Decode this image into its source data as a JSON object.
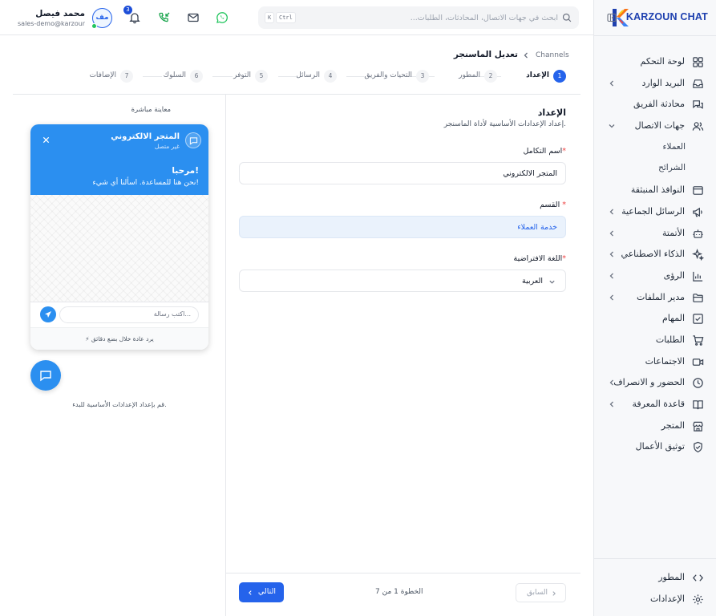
{
  "sidebar": {
    "brand": "KARZOUN CHAT",
    "items": [
      {
        "label": "لوحة التحكم",
        "icon": "grid-icon",
        "chevron": false
      },
      {
        "label": "البريد الوارد",
        "icon": "inbox-icon",
        "chevron": true
      },
      {
        "label": "محادثة الفريق",
        "icon": "chat-bubbles-icon",
        "chevron": false
      },
      {
        "label": "جهات الاتصال",
        "icon": "users-icon",
        "chevron": true,
        "expanded": true
      },
      {
        "label": "العملاء",
        "sub": true
      },
      {
        "label": "الشرائح",
        "sub": true
      },
      {
        "label": "النوافذ المنبثقة",
        "icon": "window-icon",
        "chevron": false
      },
      {
        "label": "الرسائل الجماعية",
        "icon": "megaphone-icon",
        "chevron": true
      },
      {
        "label": "الأتمتة",
        "icon": "bot-icon",
        "chevron": true
      },
      {
        "label": "الذكاء الاصطناعي",
        "icon": "sparkles-icon",
        "chevron": true
      },
      {
        "label": "الرؤى",
        "icon": "bar-chart-icon",
        "chevron": true
      },
      {
        "label": "مدير الملفات",
        "icon": "folder-icon",
        "chevron": true
      },
      {
        "label": "المهام",
        "icon": "checkbox-icon",
        "chevron": false
      },
      {
        "label": "الطلبات",
        "icon": "cart-icon",
        "chevron": false
      },
      {
        "label": "الاجتماعات",
        "icon": "video-icon",
        "chevron": false
      },
      {
        "label": "الحضور و الانصراف",
        "icon": "clock-icon",
        "chevron": true
      },
      {
        "label": "قاعدة المعرفة",
        "icon": "book-icon",
        "chevron": true
      },
      {
        "label": "المتجر",
        "icon": "store-icon",
        "chevron": false
      },
      {
        "label": "توثيق الأعمال",
        "icon": "shield-check-icon",
        "chevron": false
      }
    ],
    "bottom": [
      {
        "label": "المطور",
        "icon": "code-icon"
      },
      {
        "label": "الإعدادات",
        "icon": "gear-icon"
      }
    ]
  },
  "header": {
    "search_placeholder": "ابحث في جهات الاتصال، المحادثات، الطلبات...",
    "shortcut_keys": [
      "K",
      "Ctrl"
    ],
    "notification_count": "3",
    "user": {
      "initials": "مف",
      "name": "محمد فيصل",
      "email": "sales-demo@karzoun..."
    }
  },
  "breadcrumb": {
    "root": "Channels",
    "current": "تعديل الماسنجر"
  },
  "steps": [
    {
      "num": "1",
      "label": "الإعداد",
      "active": true
    },
    {
      "num": "2",
      "label": "المطور"
    },
    {
      "num": "3",
      "label": "التحيات والفريق"
    },
    {
      "num": "4",
      "label": "الرسائل"
    },
    {
      "num": "5",
      "label": "التوفر"
    },
    {
      "num": "6",
      "label": "السلوك"
    },
    {
      "num": "7",
      "label": "الإضافات"
    }
  ],
  "form": {
    "section_title": "الإعداد",
    "section_desc": "إعداد الإعدادات الأساسية لأداة الماسنجر.",
    "name_label": "اسم التكامل",
    "name_value": "المتجر الالكتروني",
    "dept_label": "القسم",
    "dept_value": "خدمة العملاء",
    "lang_label": "اللغة الافتراضية",
    "lang_value": "العربية",
    "required_mark": "*"
  },
  "footer": {
    "prev": "السابق",
    "step_text": "الخطوة 1 من 7",
    "next": "التالي"
  },
  "preview": {
    "title": "معاينة مباشرة",
    "store_name": "المتجر الالكتروني",
    "status": "غير متصل",
    "greeting": "مرحبا!",
    "greeting_sub": "نحن هنا للمساعدة. اسألنا أي شيء!",
    "input_placeholder": "اكتب رسالة...",
    "reply_note": "⚡ يرد عادة خلال بضع دقائق",
    "hint": "قم بإعداد الإعدادات الأساسية للبدء."
  },
  "colors": {
    "primary": "#2563eb",
    "widget": "#2b8ff0",
    "whatsapp": "#22c55e",
    "badge": "#1d4ed8"
  }
}
